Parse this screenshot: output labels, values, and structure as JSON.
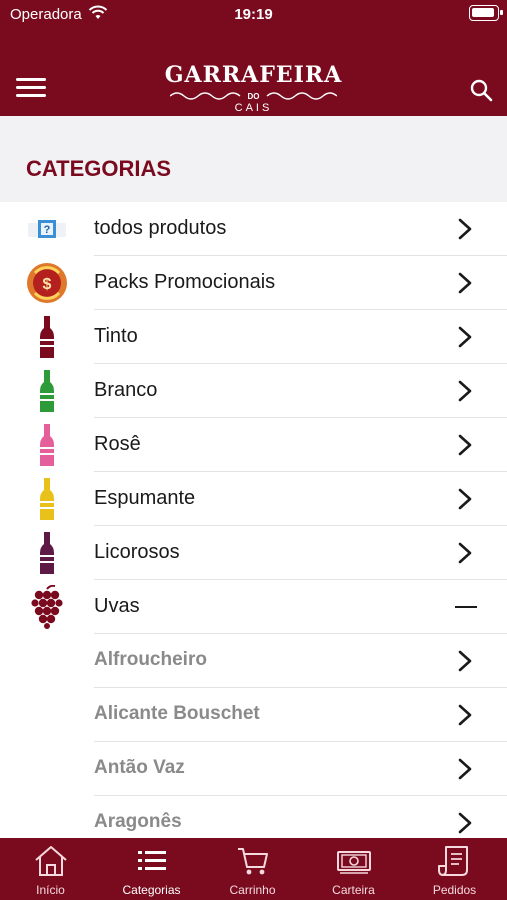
{
  "status_bar": {
    "carrier": "Operadora",
    "time": "19:19"
  },
  "header": {
    "logo_line1": "GARRAFEIRA",
    "logo_line2": "DO",
    "logo_line3": "CAIS"
  },
  "section_title": "CATEGORIAS",
  "categories": [
    {
      "label": "todos produtos",
      "icon": "question-box-icon",
      "action": "chevron"
    },
    {
      "label": "Packs Promocionais",
      "icon": "promo-coin-icon",
      "action": "chevron"
    },
    {
      "label": "Tinto",
      "icon": "red-wine-bottle-icon",
      "action": "chevron",
      "color": "#7a0b1f"
    },
    {
      "label": "Branco",
      "icon": "white-wine-bottle-icon",
      "action": "chevron",
      "color": "#2e9b3a"
    },
    {
      "label": "Rosê",
      "icon": "rose-wine-bottle-icon",
      "action": "chevron",
      "color": "#e5609a"
    },
    {
      "label": "Espumante",
      "icon": "sparkling-wine-bottle-icon",
      "action": "chevron",
      "color": "#e8c21b"
    },
    {
      "label": "Licorosos",
      "icon": "fortified-wine-bottle-icon",
      "action": "chevron",
      "color": "#5d1a45"
    },
    {
      "label": "Uvas",
      "icon": "grapes-icon",
      "action": "minus"
    }
  ],
  "grapes": [
    {
      "label": "Alfroucheiro"
    },
    {
      "label": "Alicante Bouschet"
    },
    {
      "label": "Antão Vaz"
    },
    {
      "label": "Aragonês"
    }
  ],
  "tabs": [
    {
      "label": "Início",
      "icon": "home-icon"
    },
    {
      "label": "Categorias",
      "icon": "list-icon",
      "active": true
    },
    {
      "label": "Carrinho",
      "icon": "cart-icon"
    },
    {
      "label": "Carteira",
      "icon": "wallet-cash-icon"
    },
    {
      "label": "Pedidos",
      "icon": "receipt-icon"
    }
  ],
  "colors": {
    "brand": "#7a0b1f",
    "section_bg": "#f2f2f4",
    "sub_item_text": "#8a8a8a"
  }
}
